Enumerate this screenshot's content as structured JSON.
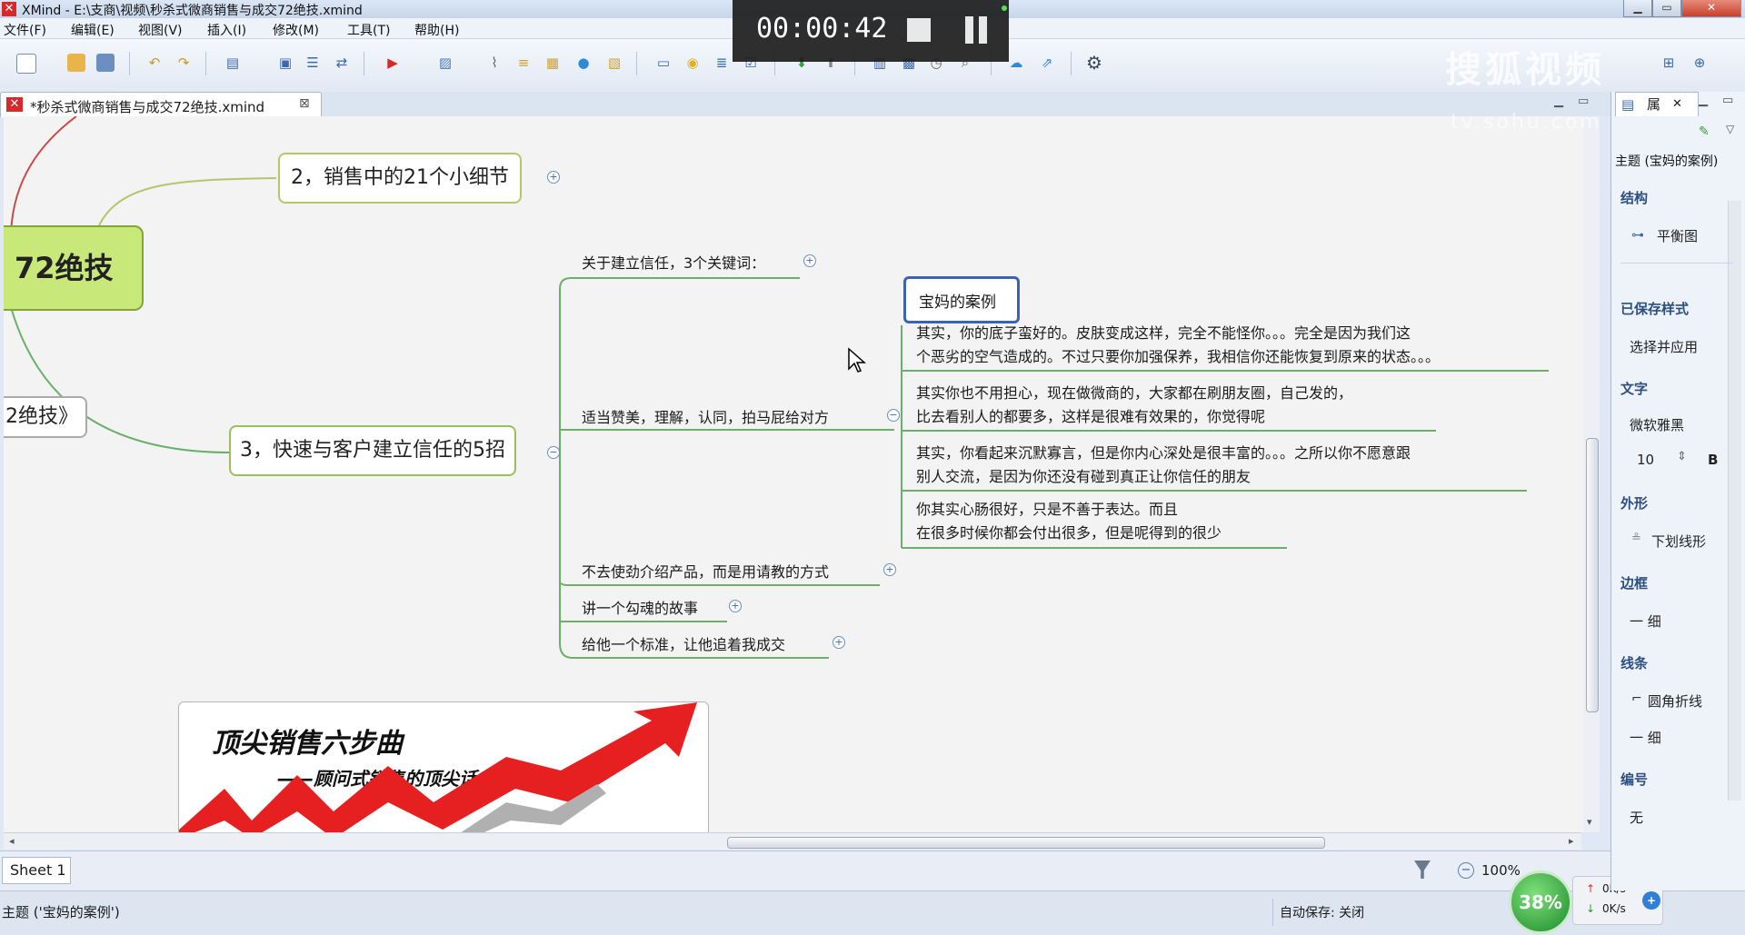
{
  "window": {
    "title": "XMind - E:\\支商\\视频\\秒杀式微商销售与成交72绝技.xmind",
    "logo": "✕"
  },
  "menu": [
    "文件(F)",
    "编辑(E)",
    "视图(V)",
    "插入(I)",
    "修改(M)",
    "工具(T)",
    "帮助(H)"
  ],
  "recorder": {
    "time": "00:00:42"
  },
  "watermark": {
    "brand": "搜狐视频",
    "url": "tv.sohu.com"
  },
  "editor_tab": {
    "title": "*秒杀式微商销售与成交72绝技.xmind"
  },
  "map": {
    "central_fragment": "72绝技",
    "left_fragment": "2绝技》",
    "topic2": "2，销售中的21个小细节",
    "topic3": "3，快速与客户建立信任的5招",
    "subtopics": [
      "关于建立信任，3个关键词：",
      "适当赞美，理解，认同，拍马屁给对方",
      "不去使劲介绍产品，而是用请教的方式",
      "讲一个勾魂的故事",
      "给他一个标准，让他追着我成交"
    ],
    "selected": "宝妈的案例",
    "notes": [
      [
        "其实，你的底子蛮好的。皮肤变成这样，完全不能怪你。。。完全是因为我们这",
        "个恶劣的空气造成的。不过只要你加强保养，我相信你还能恢复到原来的状态。。。"
      ],
      [
        "其实你也不用担心，现在做微商的，大家都在刷朋友圈，自己发的，",
        "比去看别人的都要多，这样是很难有效果的，你觉得呢"
      ],
      [
        "其实，你看起来沉默寡言，但是你内心深处是很丰富的。。。之所以你不愿意跟",
        "别人交流，是因为你还没有碰到真正让你信任的朋友"
      ],
      [
        "你其实心肠很好，只是不善于表达。而且",
        "在很多时候你都会付出很多，但是呢得到的很少"
      ]
    ],
    "image": {
      "title": "顶尖销售六步曲",
      "subtitle": "——顾问式销售的顶尖话术解析"
    }
  },
  "sheet": {
    "tab": "Sheet 1",
    "zoom": "100%"
  },
  "status": {
    "text": "主题 ('宝妈的案例')",
    "autosave": "自动保存: 关闭"
  },
  "system": {
    "cpu": "38%",
    "up": "0K/s",
    "down": "0K/s"
  },
  "panel": {
    "tab": "属",
    "header": "主题 (宝妈的案例)",
    "sections": [
      {
        "title": "结构",
        "value": "平衡图"
      },
      {
        "title": "已保存样式",
        "value": "选择并应用"
      },
      {
        "title": "文字",
        "value": "微软雅黑",
        "size": "10",
        "bold": "B"
      },
      {
        "title": "外形",
        "value": "下划线形"
      },
      {
        "title": "边框",
        "value": "一 细"
      },
      {
        "title": "线条",
        "value": "圆角折线",
        "value2": "一 细"
      },
      {
        "title": "编号",
        "value": "无"
      }
    ]
  },
  "colors": {
    "topic_border": "#9bbf5a",
    "central_fill": "#c8e87a",
    "branch": "#6ab06a",
    "selected": "#3a62b8"
  }
}
